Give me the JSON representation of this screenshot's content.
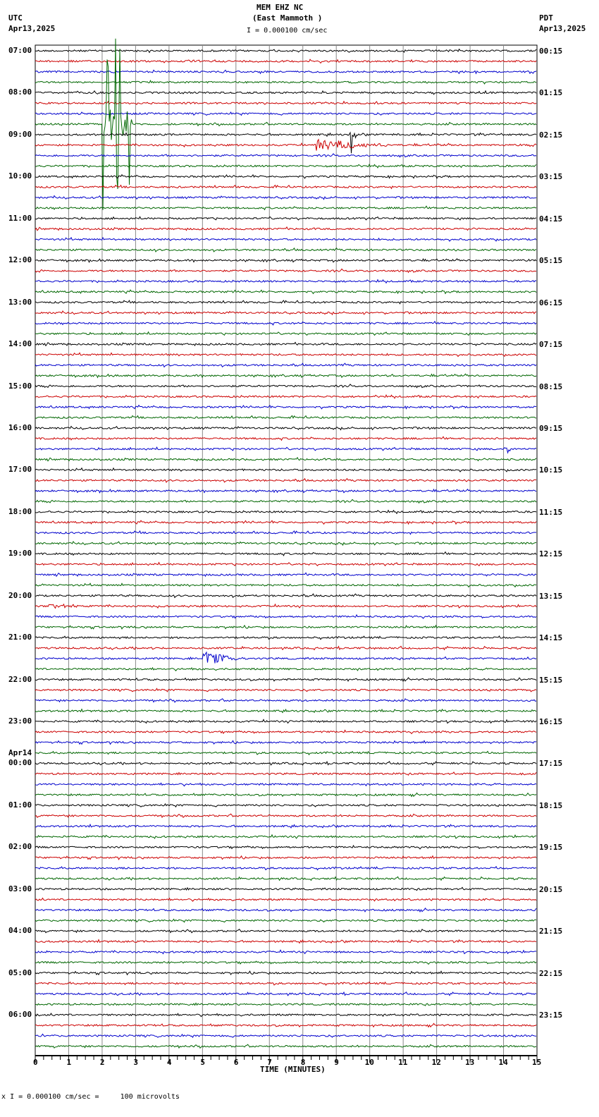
{
  "header": {
    "station": "MEM EHZ NC",
    "location": "(East Mammoth )",
    "left_tz": "UTC",
    "left_date": "Apr13,2025",
    "right_tz": "PDT",
    "right_date": "Apr13,2025",
    "scale": "= 0.000100 cm/sec"
  },
  "footer": {
    "scale": "= 0.000100 cm/sec =     100 microvolts",
    "prefix": "x"
  },
  "chart_data": {
    "type": "line",
    "title": "MEM EHZ NC (East Mammoth )",
    "xlabel": "TIME (MINUTES)",
    "xlim": [
      0,
      15
    ],
    "x_ticks": [
      "0",
      "1",
      "2",
      "3",
      "4",
      "5",
      "6",
      "7",
      "8",
      "9",
      "10",
      "11",
      "12",
      "13",
      "14",
      "15"
    ],
    "trace_minutes": 15,
    "trace_count": 96,
    "trace_colors": [
      "#000000",
      "#cc0000",
      "#0000cc",
      "#006600"
    ],
    "left_labels": [
      "07:00",
      "08:00",
      "09:00",
      "10:00",
      "11:00",
      "12:00",
      "13:00",
      "14:00",
      "15:00",
      "16:00",
      "17:00",
      "18:00",
      "19:00",
      "20:00",
      "21:00",
      "22:00",
      "23:00",
      "00:00",
      "01:00",
      "02:00",
      "03:00",
      "04:00",
      "05:00",
      "06:00"
    ],
    "date_change_label": "Apr14",
    "right_labels": [
      "00:15",
      "01:15",
      "02:15",
      "03:15",
      "04:15",
      "05:15",
      "06:15",
      "07:15",
      "08:15",
      "09:15",
      "10:15",
      "11:15",
      "12:15",
      "13:15",
      "14:15",
      "15:15",
      "16:15",
      "17:15",
      "18:15",
      "19:15",
      "20:15",
      "21:15",
      "22:15",
      "23:15"
    ],
    "events": [
      {
        "trace": 7,
        "start_min": 2.0,
        "end_min": 2.9,
        "amplitude": 9,
        "type": "spikes"
      },
      {
        "trace": 8,
        "start_min": 9.4,
        "end_min": 9.6,
        "amplitude": 2,
        "type": "spikes"
      },
      {
        "trace": 9,
        "start_min": 8.4,
        "end_min": 10.5,
        "amplitude": 1,
        "type": "burst"
      },
      {
        "trace": 53,
        "start_min": 0.4,
        "end_min": 1.5,
        "amplitude": 0.5,
        "type": "burst"
      },
      {
        "trace": 58,
        "start_min": 5.0,
        "end_min": 6.2,
        "amplitude": 1.2,
        "type": "burst"
      },
      {
        "trace": 38,
        "start_min": 14.0,
        "end_min": 14.2,
        "amplitude": 0.8,
        "type": "spikes"
      }
    ]
  }
}
